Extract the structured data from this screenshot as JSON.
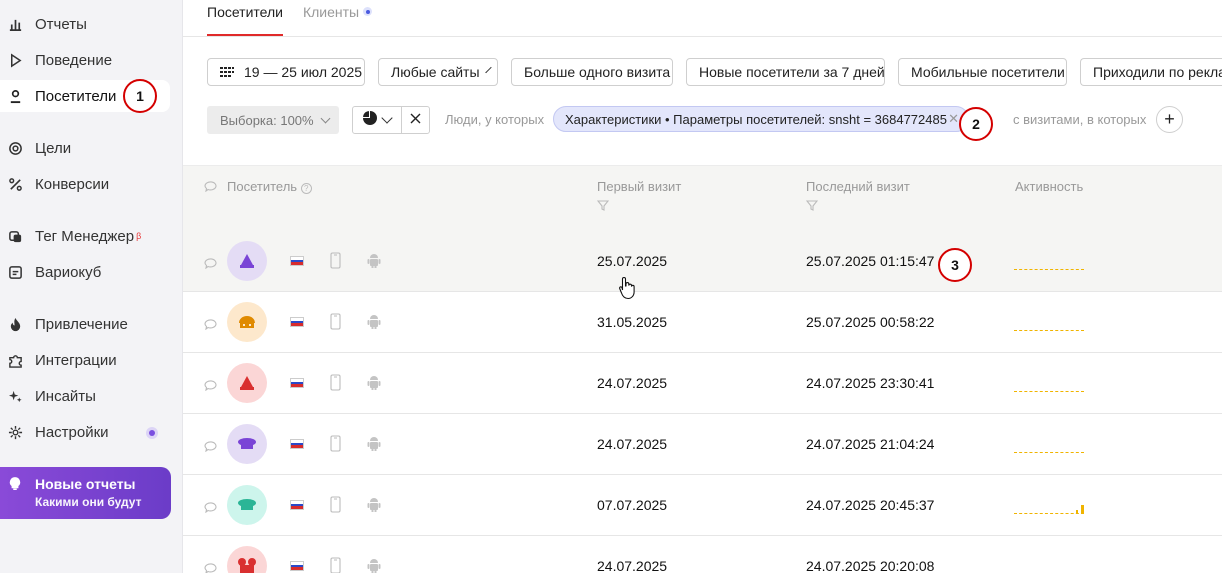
{
  "sidebar": {
    "items": [
      {
        "label": "Отчеты",
        "icon": "bar-chart-icon"
      },
      {
        "label": "Поведение",
        "icon": "play-icon"
      },
      {
        "label": "Посетители",
        "icon": "person-icon"
      },
      {
        "label": "Цели",
        "icon": "target-icon"
      },
      {
        "label": "Конверсии",
        "icon": "percent-icon"
      },
      {
        "label": "Тег Менеджер",
        "icon": "tag-manager-icon",
        "sup": "β"
      },
      {
        "label": "Вариокуб",
        "icon": "variocube-icon"
      },
      {
        "label": "Привлечение",
        "icon": "flame-icon"
      },
      {
        "label": "Интеграции",
        "icon": "puzzle-icon"
      },
      {
        "label": "Инсайты",
        "icon": "sparkle-icon"
      },
      {
        "label": "Настройки",
        "icon": "gear-icon"
      }
    ],
    "promo": {
      "title": "Новые отчеты",
      "subtitle": "Какими они будут",
      "icon": "lightbulb-icon"
    }
  },
  "markers": {
    "m1": "1",
    "m2": "2",
    "m3": "3"
  },
  "tabs": [
    {
      "label": "Посетители"
    },
    {
      "label": "Клиенты"
    }
  ],
  "filters": {
    "date": "19 — 25 июл 2025",
    "sites": "Любые сайты",
    "segments": [
      "Больше одного визита",
      "Новые посетители за 7 дней",
      "Мобильные посетители",
      "Приходили по реклам"
    ]
  },
  "segment": {
    "sample": "Выборка: 100%",
    "people_label": "Люди, у которых",
    "chip": "Характеристики • Параметры посетителей: snsht = 3684772485",
    "visits_label": "с визитами, в которых"
  },
  "table": {
    "headers": {
      "visitor": "Посетитель",
      "first": "Первый визит",
      "last": "Последний визит",
      "activity": "Активность"
    },
    "rows": [
      {
        "first": "25.07.2025",
        "last": "25.07.2025 01:15:47"
      },
      {
        "first": "31.05.2025",
        "last": "25.07.2025 00:58:22"
      },
      {
        "first": "24.07.2025",
        "last": "24.07.2025 23:30:41"
      },
      {
        "first": "24.07.2025",
        "last": "24.07.2025 21:04:24"
      },
      {
        "first": "07.07.2025",
        "last": "24.07.2025 20:45:37"
      },
      {
        "first": "24.07.2025",
        "last": "24.07.2025 20:20:08"
      }
    ]
  },
  "colors": {
    "accent_red": "#e02a2a",
    "marker_red": "#d40000",
    "chip_bg": "#e3e6fb",
    "spark": "#f0b400",
    "promo": "#7a44d6"
  }
}
